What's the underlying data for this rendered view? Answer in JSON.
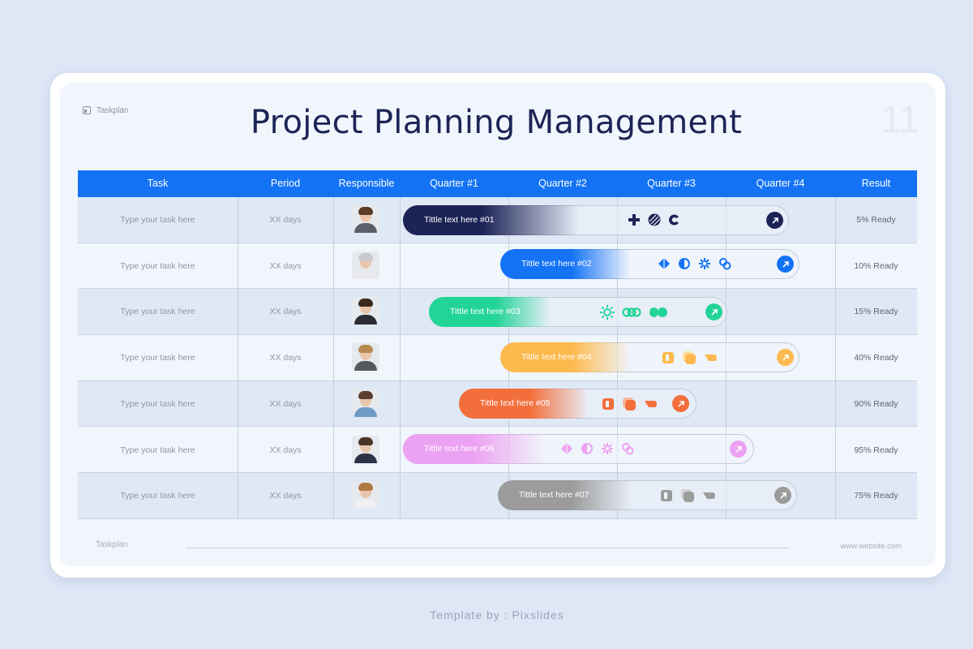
{
  "brand": {
    "name": "Taskplan"
  },
  "title": "Project Planning Management",
  "page_number": "11",
  "columns": [
    "Task",
    "Period",
    "Responsible",
    "Quarter #1",
    "Quarter #2",
    "Quarter #3",
    "Quarter #4",
    "Result"
  ],
  "rows": [
    {
      "task": "Type your task here",
      "period": "XX days",
      "bar": "Tittle text here #01",
      "result": "5% Ready"
    },
    {
      "task": "Type your task here",
      "period": "XX days",
      "bar": "Tittle text here #02",
      "result": "10% Ready"
    },
    {
      "task": "Type your task here",
      "period": "XX days",
      "bar": "Tittle text here #03",
      "result": "15% Ready"
    },
    {
      "task": "Type your task here",
      "period": "XX days",
      "bar": "Tittle text here #04",
      "result": "40% Ready"
    },
    {
      "task": "Type your task here",
      "period": "XX days",
      "bar": "Tittle text here #05",
      "result": "90% Ready"
    },
    {
      "task": "Type your task here",
      "period": "XX days",
      "bar": "Tittle text here #06",
      "result": "95% Ready"
    },
    {
      "task": "Type your task here",
      "period": "XX days",
      "bar": "Tittle text here #07",
      "result": "75% Ready"
    }
  ],
  "bar_colors": [
    "#1c2456",
    "#1473f5",
    "#23d498",
    "#fdb94d",
    "#f26f3c",
    "#eca2f2",
    "#9b9b9b"
  ],
  "footer": {
    "left": "Taskplan",
    "right": "www.website.com"
  },
  "credit": "Template by : Pixslides"
}
